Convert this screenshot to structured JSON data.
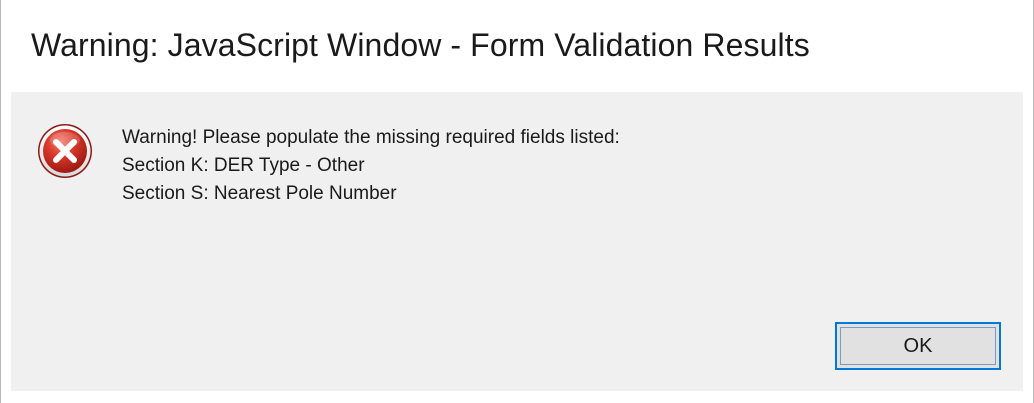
{
  "window": {
    "title": "Warning: JavaScript Window - Form Validation Results"
  },
  "message": {
    "icon": "error-icon",
    "lines": [
      "Warning! Please populate the missing required fields listed:",
      "Section K: DER Type - Other",
      "Section S: Nearest Pole Number"
    ]
  },
  "buttons": {
    "ok_label": "OK"
  },
  "colors": {
    "accent": "#0078d7",
    "icon_red": "#d32b2b",
    "panel_bg": "#f0f0f0"
  }
}
